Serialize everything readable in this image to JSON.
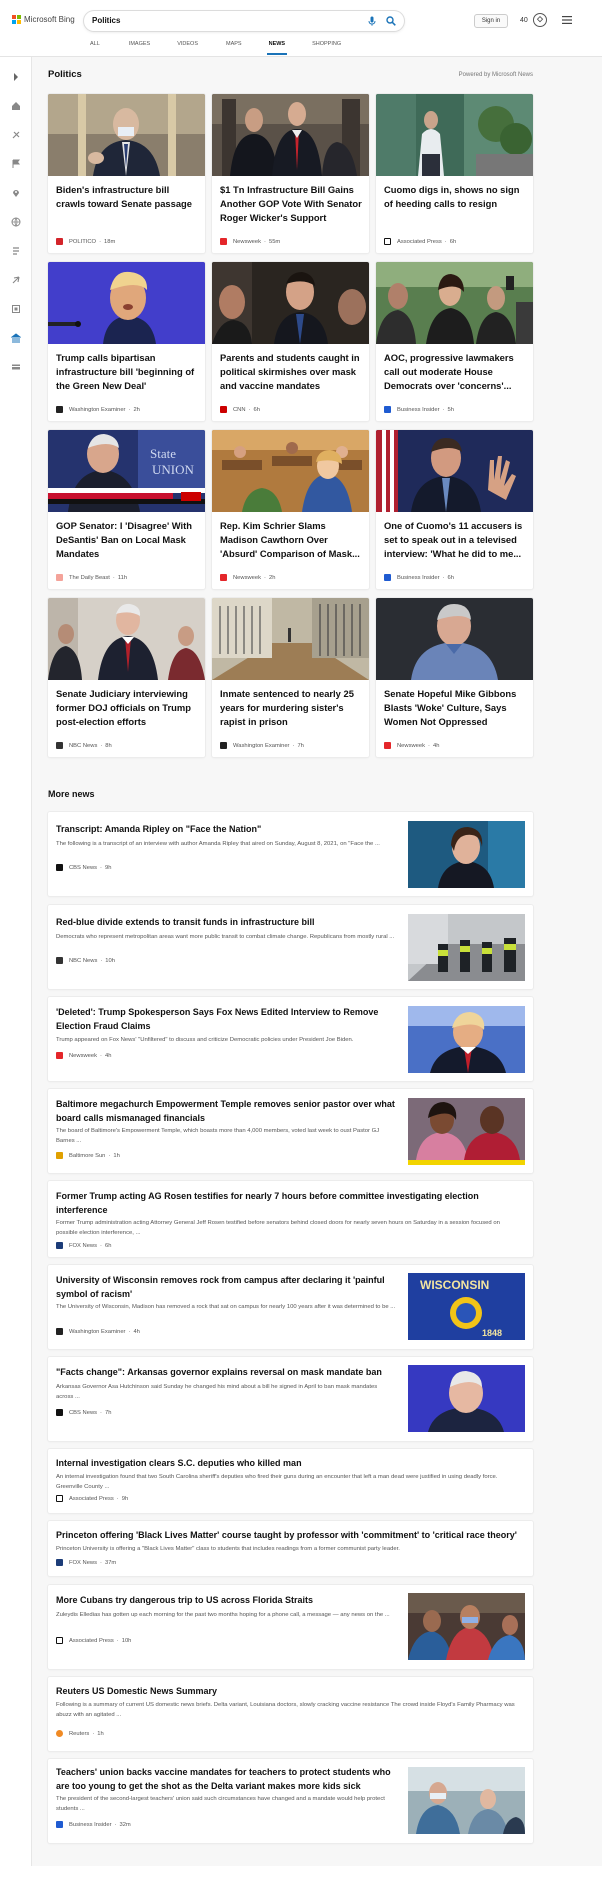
{
  "header": {
    "brand": "Microsoft Bing",
    "query": "Politics",
    "sign_in": "Sign in",
    "points": "40",
    "tabs": [
      "ALL",
      "IMAGES",
      "VIDEOS",
      "MAPS",
      "NEWS",
      "SHOPPING"
    ],
    "active_tab": "NEWS",
    "logo_colors": [
      "#f25022",
      "#7fba00",
      "#00a4ef",
      "#ffb900"
    ]
  },
  "sidebar": {
    "icons": [
      "expand-arrow",
      "home",
      "sports",
      "flag",
      "location",
      "globe",
      "science",
      "rocket",
      "entertainment",
      "business",
      "money"
    ]
  },
  "top": {
    "title": "Politics",
    "powered_by": "Powered by Microsoft News",
    "stories": [
      {
        "title": "Biden's infrastructure bill crawls toward Senate passage",
        "source": "POLITICO",
        "time": "18m",
        "src_color": "#d3242a"
      },
      {
        "title": "$1 Tn Infrastructure Bill Gains Another GOP Vote With Senator Roger Wicker's Support",
        "source": "Newsweek",
        "time": "55m",
        "src_color": "#e4262a"
      },
      {
        "title": "Cuomo digs in, shows no sign of heeding calls to resign",
        "source": "Associated Press",
        "time": "6h",
        "src_color": "#111111"
      },
      {
        "title": "Trump calls bipartisan infrastructure bill 'beginning of the Green New Deal'",
        "source": "Washington Examiner",
        "time": "2h",
        "src_color": "#222222"
      },
      {
        "title": "Parents and students caught in political skirmishes over mask and vaccine mandates",
        "source": "CNN",
        "time": "6h",
        "src_color": "#cc0000"
      },
      {
        "title": "AOC, progressive lawmakers call out moderate House Democrats over 'concerns'...",
        "source": "Business Insider",
        "time": "5h",
        "src_color": "#1f5bd1"
      },
      {
        "title": "GOP Senator: I 'Disagree' With DeSantis' Ban on Local Mask Mandates",
        "source": "The Daily Beast",
        "time": "11h",
        "src_color": "#f4a39a"
      },
      {
        "title": "Rep. Kim Schrier Slams Madison Cawthorn Over 'Absurd' Comparison of Mask...",
        "source": "Newsweek",
        "time": "2h",
        "src_color": "#e4262a"
      },
      {
        "title": "One of Cuomo's 11 accusers is set to speak out in a televised interview: 'What he did to me...",
        "source": "Business Insider",
        "time": "6h",
        "src_color": "#1f5bd1"
      },
      {
        "title": "Senate Judiciary interviewing former DOJ officials on Trump post-election efforts",
        "source": "NBC News",
        "time": "8h",
        "src_color": "#333333"
      },
      {
        "title": "Inmate sentenced to nearly 25 years for murdering sister's rapist in prison",
        "source": "Washington Examiner",
        "time": "7h",
        "src_color": "#222222"
      },
      {
        "title": "Senate Hopeful Mike Gibbons Blasts 'Woke' Culture, Says Women Not Oppressed",
        "source": "Newsweek",
        "time": "4h",
        "src_color": "#e4262a"
      }
    ]
  },
  "more": {
    "title": "More news",
    "items": [
      {
        "title": "Transcript: Amanda Ripley on \"Face the Nation\"",
        "snippet": "The following is a transcript of an interview with author Amanda Ripley that aired on Sunday, August 8, 2021, on \"Face the ...",
        "source": "CBS News",
        "time": "9h",
        "src_color": "#111111"
      },
      {
        "title": "Red-blue divide extends to transit funds in infrastructure bill",
        "snippet": "Democrats who represent metropolitan areas want more public transit to combat climate change. Republicans from mostly rural ...",
        "source": "NBC News",
        "time": "10h",
        "src_color": "#333333"
      },
      {
        "title": "'Deleted': Trump Spokesperson Says Fox News Edited Interview to Remove Election Fraud Claims",
        "snippet": "Trump appeared on Fox News' \"Unfiltered\" to discuss and criticize Democratic policies under President Joe Biden.",
        "source": "Newsweek",
        "time": "4h",
        "src_color": "#e4262a"
      },
      {
        "title": "Baltimore megachurch Empowerment Temple removes senior pastor over what board calls mismanaged financials",
        "snippet": "The board of Baltimore's Empowerment Temple, which boasts more than 4,000 members, voted last week to oust Pastor GJ Barnes ...",
        "source": "Baltimore Sun",
        "time": "1h",
        "src_color": "#e0a000"
      },
      {
        "title": "Former Trump acting AG Rosen testifies for nearly 7 hours before committee investigating election interference",
        "snippet": "Former Trump administration acting Attorney General Jeff Rosen testified before senators behind closed doors for nearly seven hours on Saturday in a session focused on possible election interference, ...",
        "source": "FOX News",
        "time": "6h",
        "src_color": "#1c3c78"
      },
      {
        "title": "University of Wisconsin removes rock from campus after declaring it 'painful symbol of racism'",
        "snippet": "The University of Wisconsin, Madison has removed a rock that sat on campus for nearly 100 years after it was determined to be ...",
        "source": "Washington Examiner",
        "time": "4h",
        "src_color": "#222222"
      },
      {
        "title": "\"Facts change\": Arkansas governor explains reversal on mask mandate ban",
        "snippet": "Arkansas Governor Asa Hutchinson said Sunday he changed his mind about a bill he signed in April to ban mask mandates across ...",
        "source": "CBS News",
        "time": "7h",
        "src_color": "#111111"
      },
      {
        "title": "Internal investigation clears S.C. deputies who killed man",
        "snippet": "An internal investigation found that two South Carolina sheriff's deputies who fired their guns during an encounter that left a man dead were justified in using deadly force. Greenville County ...",
        "source": "Associated Press",
        "time": "9h",
        "src_color": "#111111"
      },
      {
        "title": "Princeton offering 'Black Lives Matter' course taught by professor with 'commitment' to 'critical race theory'",
        "snippet": "Princeton University is offering a \"Black Lives Matter\" class to students that includes readings from a former communist party leader.",
        "source": "FOX News",
        "time": "37m",
        "src_color": "#1c3c78"
      },
      {
        "title": "More Cubans try dangerous trip to US across Florida Straits",
        "snippet": "Zuleydis Elledias has gotten up each morning for the past two months hoping for a phone call, a message — any news on the ...",
        "source": "Associated Press",
        "time": "10h",
        "src_color": "#111111"
      },
      {
        "title": "Reuters US Domestic News Summary",
        "snippet": "Following is a summary of current US domestic news briefs. Delta variant, Louisiana doctors, slowly cracking vaccine resistance The crowd inside Floyd's Family Pharmacy was abuzz with an agitated ...",
        "source": "Reuters",
        "time": "1h",
        "src_color": "#f08a24"
      },
      {
        "title": "Teachers' union backs vaccine mandates for teachers to protect students who are too young to get the shot as the Delta variant makes more kids sick",
        "snippet": "The president of the second-largest teachers' union said such circumstances have changed and a mandate would help protect students ...",
        "source": "Business Insider",
        "time": "32m",
        "src_color": "#1f5bd1"
      }
    ]
  }
}
